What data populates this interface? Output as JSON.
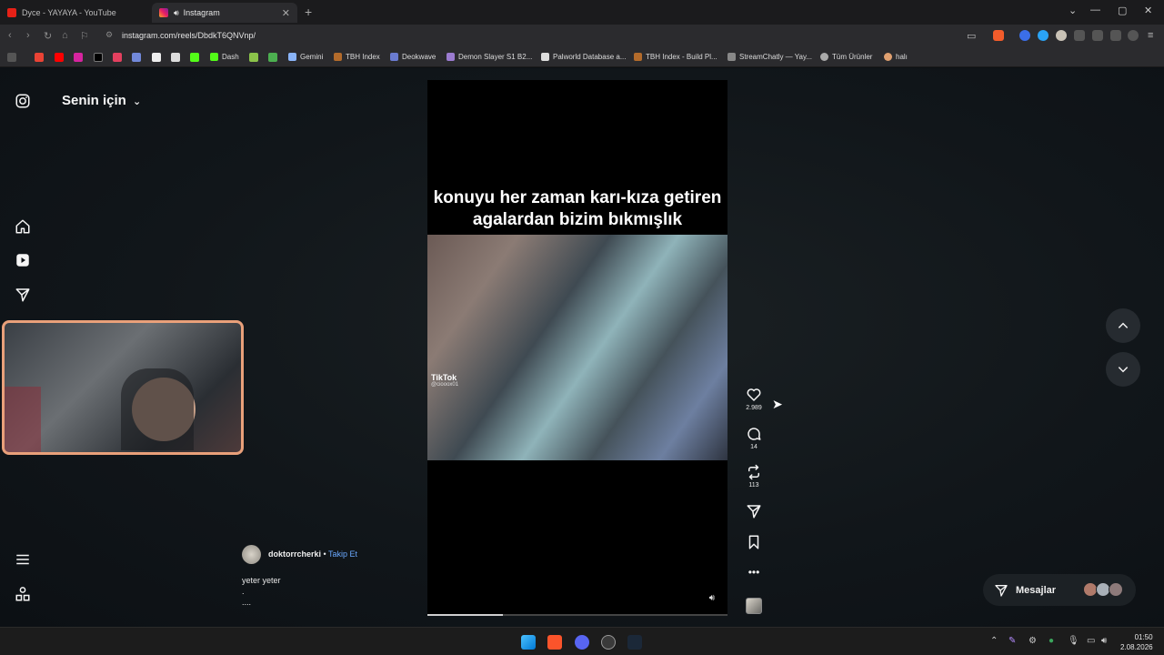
{
  "browser": {
    "tabs": [
      {
        "label": "Dyce - YAYAYA - YouTube",
        "active": false
      },
      {
        "label": "Instagram",
        "active": true
      }
    ],
    "url": "instagram.com/reels/DbdkT6QNVnp/",
    "bookmarks": [
      "Dash",
      "Gemini",
      "TBH Index",
      "Deokwave",
      "Demon Slayer S1 B2...",
      "Palworld Database a...",
      "TBH Index - Build Pl...",
      "StreamChatly — Yay...",
      "Tüm Ürünler",
      "halı"
    ]
  },
  "sidebar": {
    "feed_title": "Senin için",
    "items": [
      "instagram-logo",
      "home-icon",
      "reels-icon",
      "send-icon",
      "menu-icon",
      "more-icon"
    ]
  },
  "reel": {
    "caption": "konuyu her zaman karı-kıza getiren agalardan bizim bıkmışlık",
    "watermark_brand": "TikTok",
    "watermark_handle": "@ciooox01",
    "progress": 0.25,
    "likes": "2.989",
    "comments": "14",
    "reposts": "113",
    "author": "doktorrcherki",
    "follow_label": "Takip Et",
    "separator": "•",
    "description": "yeter yeter\n.\n...."
  },
  "messages": {
    "label": "Mesajlar"
  },
  "taskbar": {
    "time": "01:50",
    "date": "2.08.2026"
  },
  "colors": {
    "accent_link": "#6aa9ff",
    "page_bg": "#0c1014",
    "webcam_border": "#e9a07a"
  }
}
